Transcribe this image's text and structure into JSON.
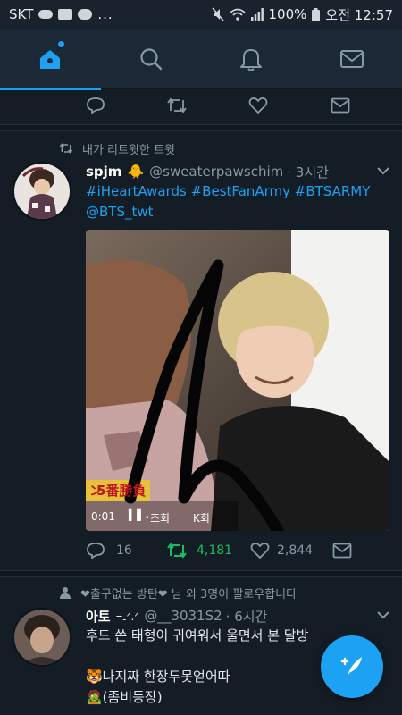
{
  "status_bar": {
    "carrier": "SKT",
    "notif_more": "...",
    "battery": "100%",
    "time": "오전 12:57"
  },
  "nav": {
    "tabs": [
      {
        "name": "home",
        "icon": "home-icon",
        "active": true
      },
      {
        "name": "search",
        "icon": "search-icon",
        "active": false
      },
      {
        "name": "notifications",
        "icon": "bell-icon",
        "active": false
      },
      {
        "name": "messages",
        "icon": "mail-icon",
        "active": false
      }
    ],
    "accent": "#1da1f2"
  },
  "prev_tweet_actions": {
    "reply_icon": "reply-icon",
    "retweet_icon": "retweet-icon",
    "like_icon": "heart-icon",
    "dm_icon": "mail-icon"
  },
  "tweet1": {
    "context": "내가 리트윗한 트윗",
    "name": "spjm",
    "emoji": "🐥",
    "handle": "@sweaterpawschim",
    "time": "· 3시간",
    "text_line1": "#iHeartAwards #BestFanArmy #BTSARMY",
    "text_line2": "@BTS_twt",
    "media": {
      "video_time": "0:01",
      "overlay_text": "5番勝負",
      "views_text": "조회",
      "count_suffix": "K회"
    },
    "replies": "16",
    "retweets": "4,181",
    "retweet_color": "#17bf63",
    "likes": "2,844"
  },
  "tweet2": {
    "context": "❤출구없는 방탄❤ 님 외 3명이 팔로우합니다",
    "name": "아토",
    "name_extra": "ᯓᐟ.ᐟ",
    "handle": "@__3031S2",
    "time": "· 6시간",
    "line1": "후드 쓴 태형이 귀여워서 울면서 본 달방",
    "line2": "🐯나지짜 한장두못얻어따",
    "line3": "🧟(좀비등장)"
  },
  "fab": {
    "icon": "compose-icon"
  }
}
